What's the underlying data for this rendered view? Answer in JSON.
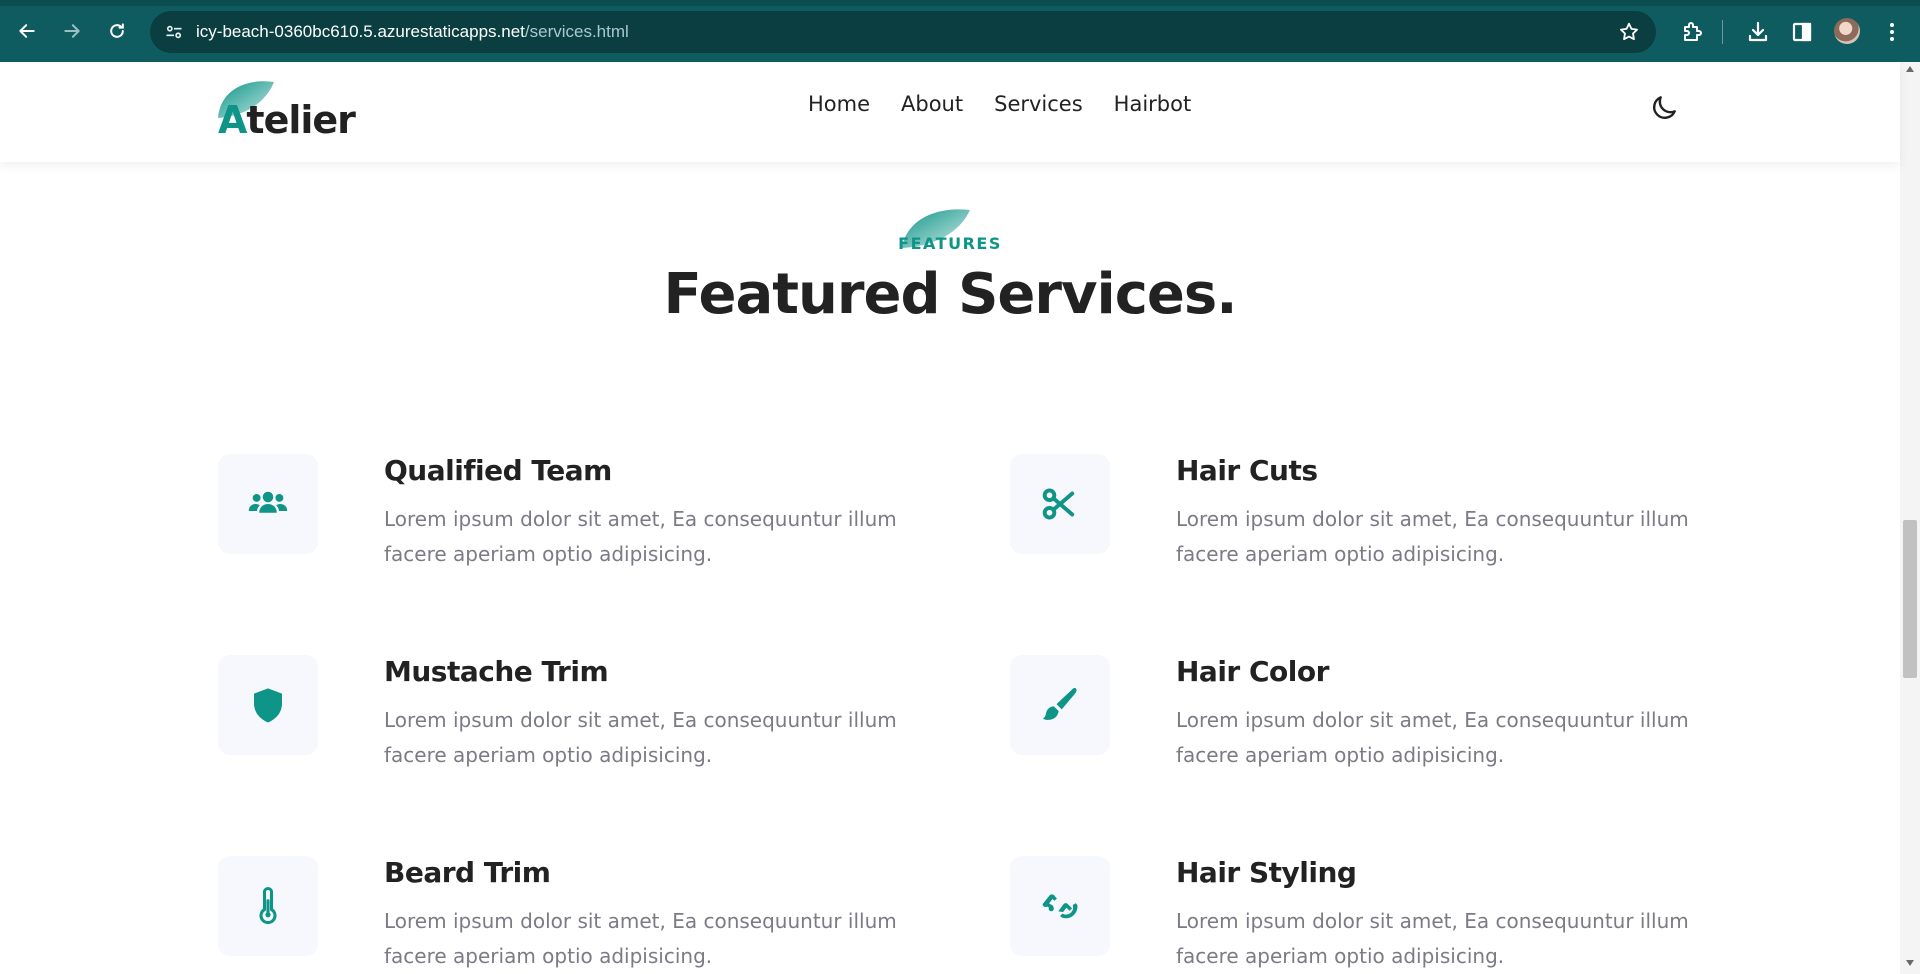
{
  "browser": {
    "url_domain": "icy-beach-0360bc610.5.azurestaticapps.net",
    "url_path": "/services.html"
  },
  "header": {
    "logo_first_letter": "A",
    "logo_rest": "telier",
    "nav": [
      {
        "label": "Home"
      },
      {
        "label": "About"
      },
      {
        "label": "Services"
      },
      {
        "label": "Hairbot"
      }
    ]
  },
  "section": {
    "eyebrow": "FEATURES",
    "title": "Featured Services."
  },
  "services": [
    {
      "title": "Qualified Team",
      "description": "Lorem ipsum dolor sit amet, Ea consequuntur illum facere aperiam optio adipisicing.",
      "icon": "users-icon"
    },
    {
      "title": "Hair Cuts",
      "description": "Lorem ipsum dolor sit amet, Ea consequuntur illum facere aperiam optio adipisicing.",
      "icon": "scissors-icon"
    },
    {
      "title": "Mustache Trim",
      "description": "Lorem ipsum dolor sit amet, Ea consequuntur illum facere aperiam optio adipisicing.",
      "icon": "shield-icon"
    },
    {
      "title": "Hair Color",
      "description": "Lorem ipsum dolor sit amet, Ea consequuntur illum facere aperiam optio adipisicing.",
      "icon": "paintbrush-icon"
    },
    {
      "title": "Beard Trim",
      "description": "Lorem ipsum dolor sit amet, Ea consequuntur illum facere aperiam optio adipisicing.",
      "icon": "thermometer-icon"
    },
    {
      "title": "Hair Styling",
      "description": "Lorem ipsum dolor sit amet, Ea consequuntur illum facere aperiam optio adipisicing.",
      "icon": "hands-icon"
    }
  ],
  "colors": {
    "accent": "#0f9488",
    "browser_chrome": "#0e5c5f",
    "heading": "#222222",
    "body_text": "#7b7b86",
    "icon_box": "#f7f8fd"
  }
}
